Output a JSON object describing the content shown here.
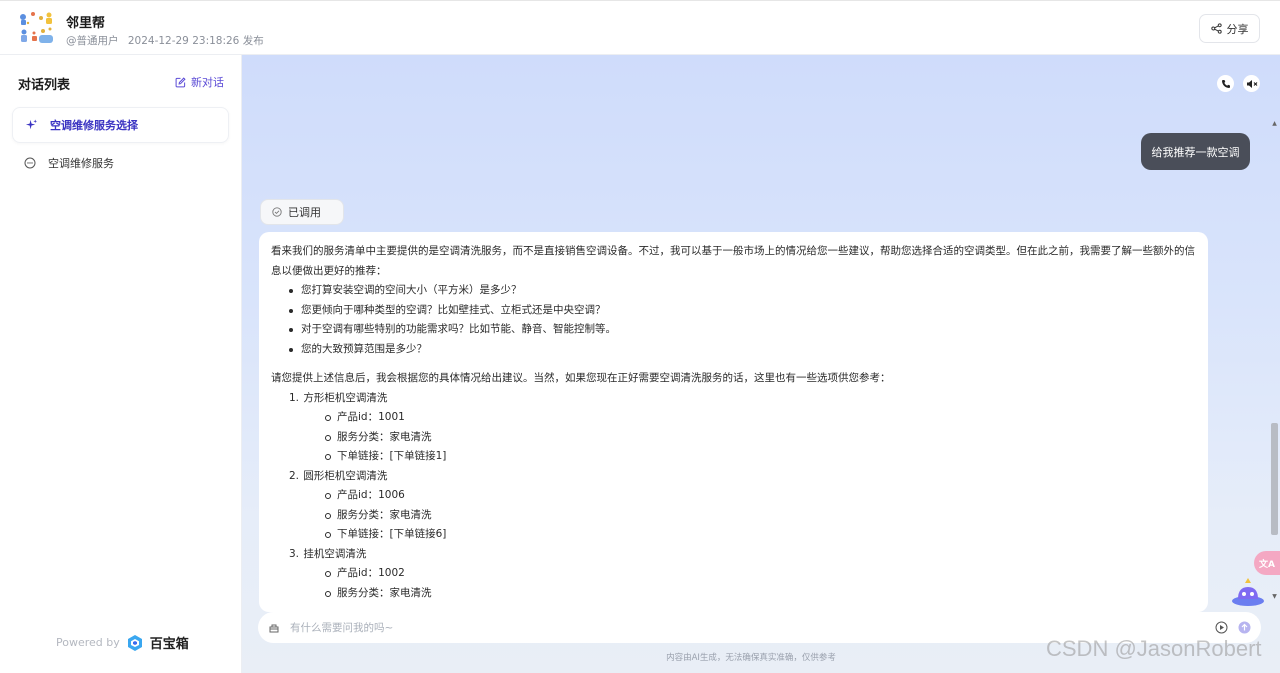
{
  "header": {
    "app_name": "邻里帮",
    "author": "@普通用户",
    "published": "2024-12-29 23:18:26 发布",
    "share_label": "分享"
  },
  "sidebar": {
    "title": "对话列表",
    "new_chat_label": "新对话",
    "conversations": [
      {
        "label": "空调维修服务选择",
        "active": true
      },
      {
        "label": "空调维修服务",
        "active": false
      }
    ],
    "powered_by": "Powered by",
    "brand": "百宝箱"
  },
  "chat": {
    "user_message": "给我推荐一款空调",
    "tool_status": "已调用",
    "answer": {
      "intro": "看来我们的服务清单中主要提供的是空调清洗服务，而不是直接销售空调设备。不过，我可以基于一般市场上的情况给您一些建议，帮助您选择合适的空调类型。但在此之前，我需要了解一些额外的信息以便做出更好的推荐：",
      "questions": [
        "您打算安装空调的空间大小（平方米）是多少？",
        "您更倾向于哪种类型的空调？比如壁挂式、立柜式还是中央空调？",
        "对于空调有哪些特别的功能需求吗？比如节能、静音、智能控制等。",
        "您的大致预算范围是多少？"
      ],
      "followup": "请您提供上述信息后，我会根据您的具体情况给出建议。当然，如果您现在正好需要空调清洗服务的话，这里也有一些选项供您参考：",
      "options": [
        {
          "num": "1.",
          "name": "方形柜机空调清洗",
          "details": [
            "产品id：1001",
            "服务分类：家电清洗",
            "下单链接：[下单链接1]"
          ]
        },
        {
          "num": "2.",
          "name": "圆形柜机空调清洗",
          "details": [
            "产品id：1006",
            "服务分类：家电清洗",
            "下单链接：[下单链接6]"
          ]
        },
        {
          "num": "3.",
          "name": "挂机空调清洗",
          "details": [
            "产品id：1002",
            "服务分类：家电清洗"
          ]
        }
      ]
    },
    "input_placeholder": "有什么需要问我的吗~",
    "disclaimer": "内容由AI生成，无法确保真实准确，仅供参考",
    "translate_badge": "文A"
  },
  "watermark": "CSDN @JasonRobert",
  "colors": {
    "accent": "#5b4bd6",
    "user_bubble": "#4a4e59"
  }
}
